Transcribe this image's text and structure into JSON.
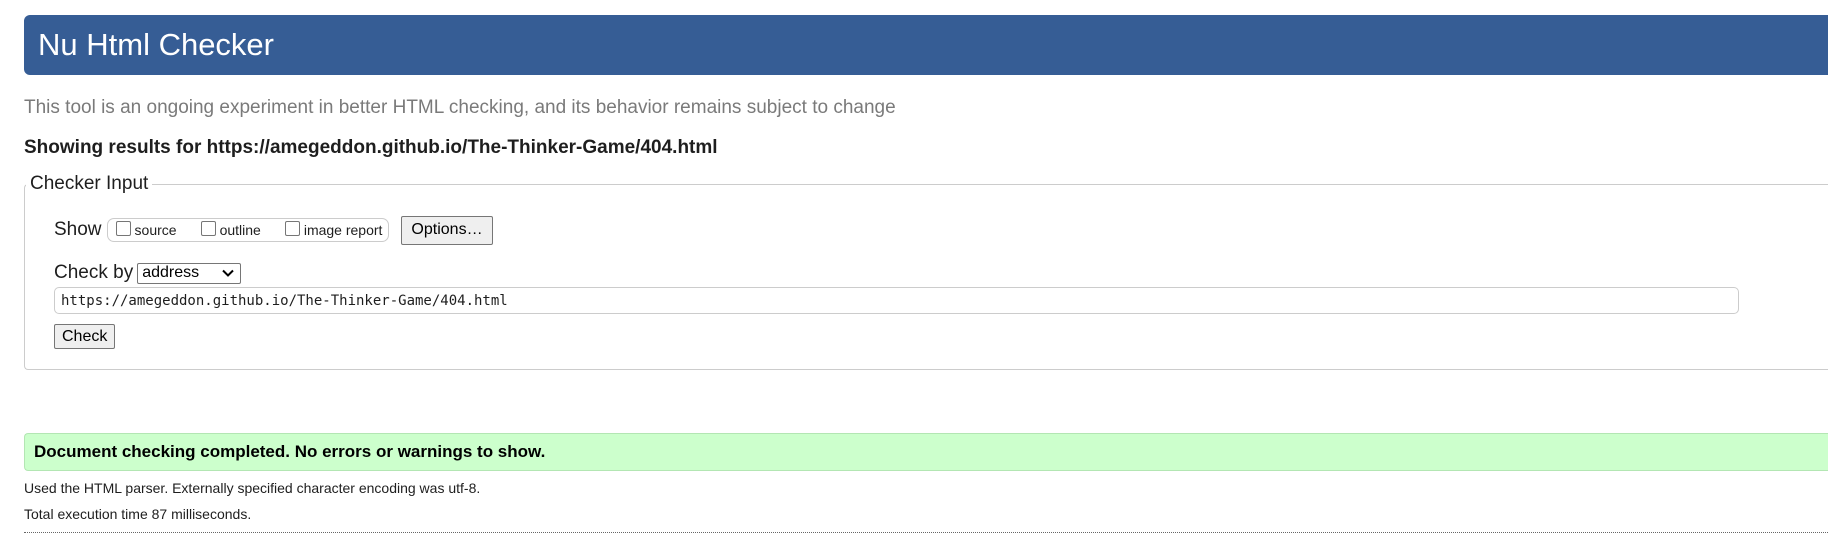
{
  "header": {
    "title": "Nu Html Checker"
  },
  "subtitle": "This tool is an ongoing experiment in better HTML checking, and its behavior remains subject to change",
  "results_line": "Showing results for https://amegeddon.github.io/The-Thinker-Game/404.html",
  "checker_input": {
    "legend": "Checker Input",
    "show_label": "Show",
    "show_options": [
      {
        "label": "source",
        "checked": false
      },
      {
        "label": "outline",
        "checked": false
      },
      {
        "label": "image report",
        "checked": false
      }
    ],
    "options_button": "Options…",
    "check_by_label": "Check by",
    "check_by_selected": "address",
    "url_value": "https://amegeddon.github.io/The-Thinker-Game/404.html",
    "check_button": "Check"
  },
  "result": {
    "message": "Document checking completed. No errors or warnings to show.",
    "parser_info": "Used the HTML parser. Externally specified character encoding was utf-8.",
    "execution_time": "Total execution time 87 milliseconds."
  },
  "colors": {
    "banner": "#365d95",
    "success_bg": "#ccffcc"
  }
}
